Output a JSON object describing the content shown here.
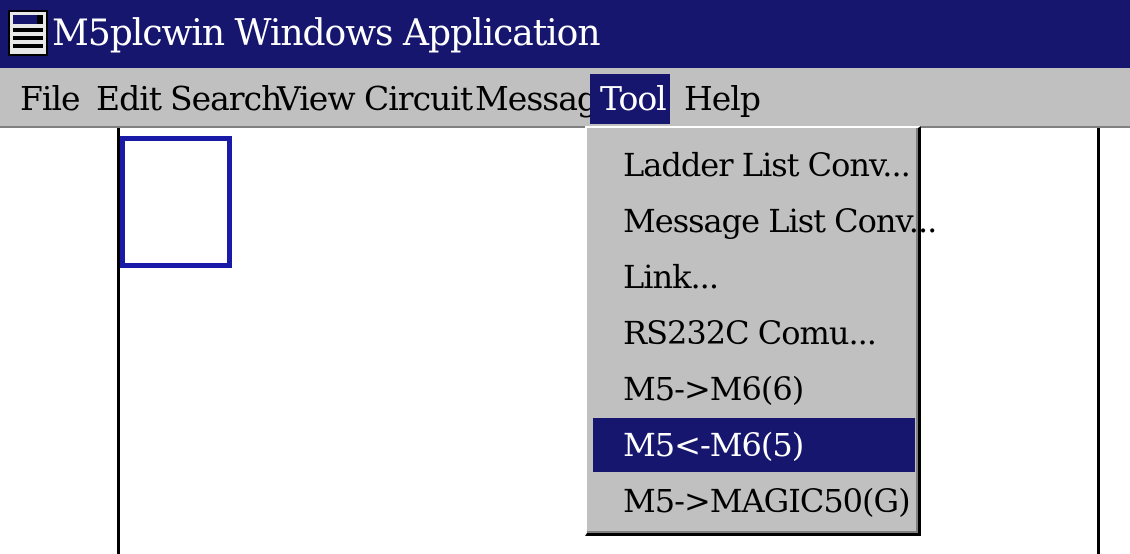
{
  "window": {
    "title": "M5plcwin Windows Application",
    "icon": "app-window-icon"
  },
  "menubar": {
    "items": [
      {
        "label": "File"
      },
      {
        "label": "Edit"
      },
      {
        "label": "Search"
      },
      {
        "label": "View"
      },
      {
        "label": "Circuit"
      },
      {
        "label": "Message"
      },
      {
        "label": "Tool",
        "active": true
      },
      {
        "label": "Help"
      }
    ]
  },
  "tool_menu": {
    "items": [
      {
        "label": "Ladder List Conv..."
      },
      {
        "label": "Message List Conv..."
      },
      {
        "label": "Link..."
      },
      {
        "label": "RS232C Comu..."
      },
      {
        "label": "M5->M6(6)"
      },
      {
        "label": "M5<-M6(5)",
        "selected": true
      },
      {
        "label": "M5->MAGIC50(G)"
      }
    ]
  },
  "colors": {
    "titlebar": "#16166e",
    "menu_bg": "#c0c0c0",
    "highlight": "#16166e",
    "cursor_box": "#1a1aa8"
  }
}
